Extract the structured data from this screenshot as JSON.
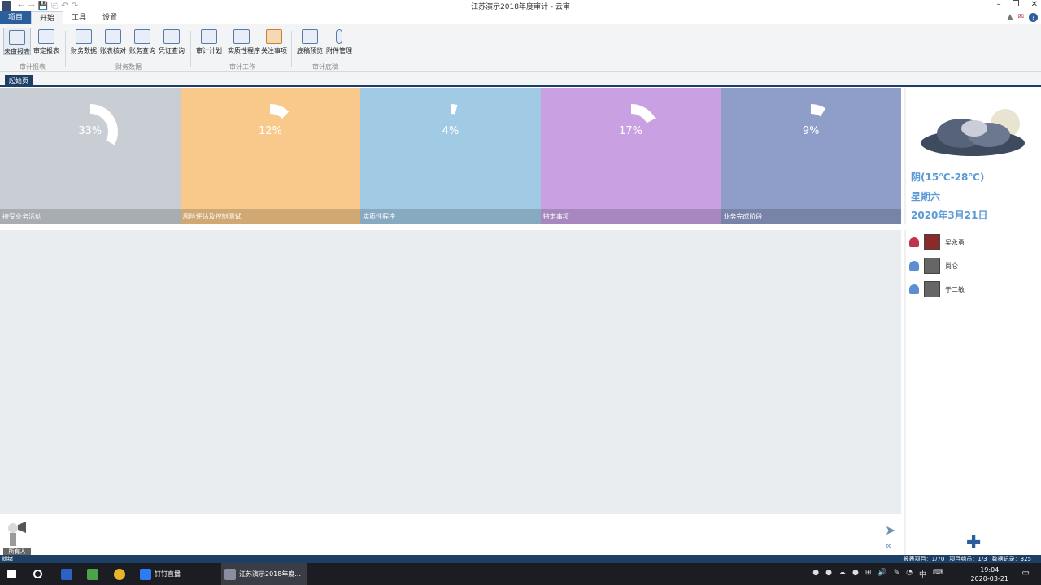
{
  "window": {
    "title": "江苏演示2018年度审计 - 云审",
    "minimize": "–",
    "restore": "❐",
    "close": "✕"
  },
  "quick_access": [
    "←",
    "→",
    "💾",
    "⎘",
    "↶",
    "↷"
  ],
  "menu": {
    "project": "项目",
    "items": [
      "开始",
      "工具",
      "设置"
    ]
  },
  "ribbon_right": [
    "▲",
    "✉",
    "?"
  ],
  "ribbon": {
    "buttons": [
      "未审报表",
      "审定报表",
      "财务数据",
      "账表核对",
      "账务查询",
      "凭证查询",
      "审计计划",
      "实质性程序",
      "关注事项",
      "底稿预览",
      "附件管理"
    ],
    "groups": [
      "审计报表",
      "财务数据",
      "审计工作",
      "审计底稿"
    ]
  },
  "tabs": {
    "home": "起始页"
  },
  "tiles": [
    {
      "pct": "33%",
      "caption": "接受业务活动",
      "color": "#c9ced4",
      "value": 0.33
    },
    {
      "pct": "12%",
      "caption": "风险评估及控制测试",
      "color": "#f8c98b",
      "value": 0.12
    },
    {
      "pct": "4%",
      "caption": "实质性程序",
      "color": "#a1cbe5",
      "value": 0.04
    },
    {
      "pct": "17%",
      "caption": "特定事项",
      "color": "#c9a1e3",
      "value": 0.17
    },
    {
      "pct": "9%",
      "caption": "业务完成阶段",
      "color": "#8f9dc9",
      "value": 0.09
    }
  ],
  "weather": {
    "condition": "阴(15℃-28℃)",
    "weekday": "星期六",
    "date": "2020年3月21日"
  },
  "members": [
    {
      "name": "吴永勇",
      "pin_color": "#c0334d"
    },
    {
      "name": "尚仑",
      "pin_color": "#5b8fd1"
    },
    {
      "name": "于二敏",
      "pin_color": "#5b8fd1"
    }
  ],
  "chat": {
    "all_label": "所有人"
  },
  "status": {
    "left": "就绪",
    "right": [
      "报表项目：1/70",
      "项目组员：1/3",
      "数据记录：325"
    ]
  },
  "taskbar": {
    "apps": [
      "钉钉直播",
      "江苏演示2018年度..."
    ],
    "time": "19:04",
    "date": "2020-03-21",
    "ime": "中"
  }
}
